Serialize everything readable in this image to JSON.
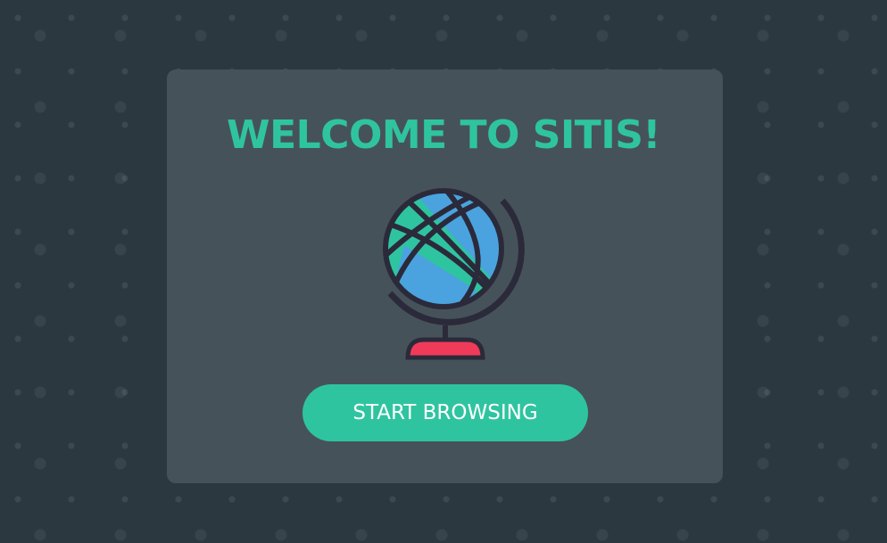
{
  "welcome": {
    "title": "WELCOME TO SITIS!",
    "button_label": "START BROWSING"
  },
  "colors": {
    "accent": "#2fc4a0",
    "card": "#465259",
    "background": "#2c3840",
    "globe_ocean": "#4aa3df",
    "globe_base": "#f03a5a"
  },
  "icons": {
    "hero": "globe-icon"
  }
}
